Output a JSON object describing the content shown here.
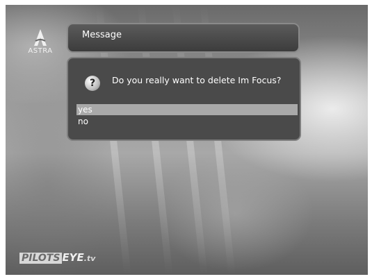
{
  "logo_top": {
    "text": "ASTRA"
  },
  "message_bar": {
    "title": "Message"
  },
  "dialog": {
    "icon": "question-icon",
    "prompt": "Do you really want to delete Im Focus?",
    "options": [
      {
        "label": "yes",
        "selected": true
      },
      {
        "label": "no",
        "selected": false
      }
    ]
  },
  "logo_bottom": {
    "box_text": "PILOTS",
    "main_text": "EYE",
    "suffix_text": ".tv"
  },
  "colors": {
    "selected_bg": "#a9a9a9",
    "dialog_bg": "#4a4a4a",
    "text": "#ffffff"
  }
}
